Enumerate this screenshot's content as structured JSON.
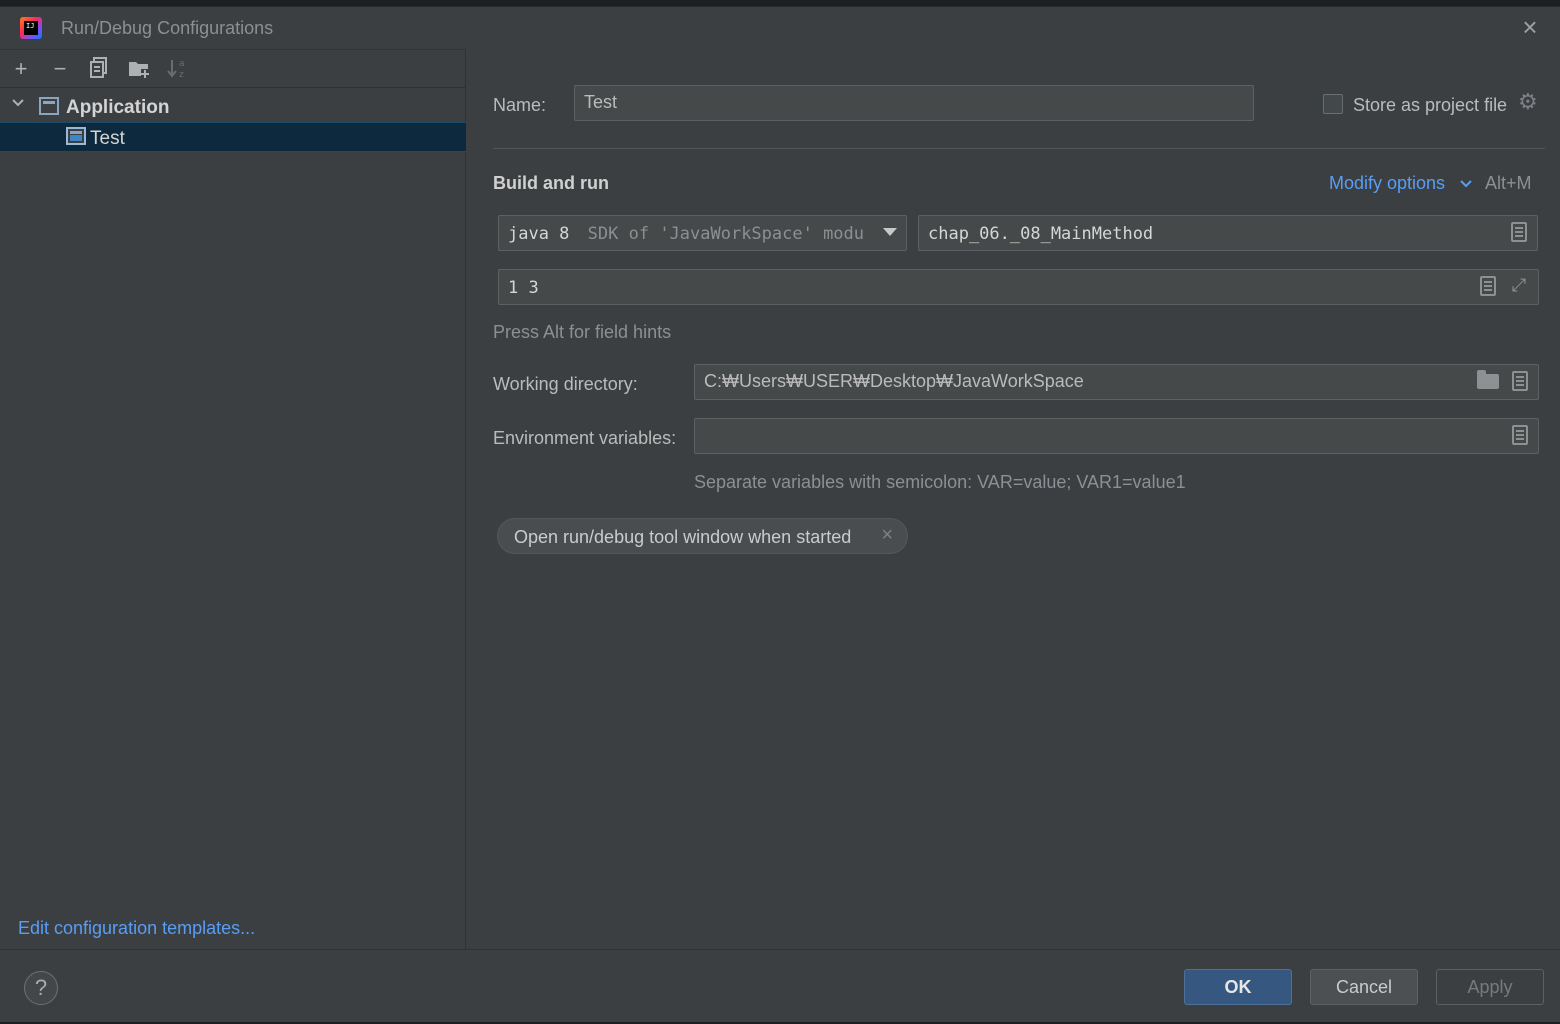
{
  "window": {
    "title": "Run/Debug Configurations",
    "close_icon": "close-icon"
  },
  "toolbar": {
    "add": "+",
    "remove": "−",
    "copy_icon": "copy-icon",
    "folder_icon": "new-folder-icon",
    "sort_icon": "sort-icon"
  },
  "tree": {
    "group_label": "Application",
    "item_label": "Test"
  },
  "left_footer": {
    "edit_templates": "Edit configuration templates..."
  },
  "form": {
    "name_label": "Name:",
    "name_value": "Test",
    "store_label": "Store as project file",
    "section_title": "Build and run",
    "modify_options": "Modify options",
    "modify_shortcut": "Alt+M",
    "sdk_value": "java 8",
    "sdk_detail": "SDK of 'JavaWorkSpace' modu",
    "main_class": "chap_06._08_MainMethod",
    "program_args": "1 3",
    "field_hints": "Press Alt for field hints",
    "working_dir_label": "Working directory:",
    "working_dir_value": "C:₩Users₩USER₩Desktop₩JavaWorkSpace",
    "env_label": "Environment variables:",
    "env_value": "",
    "env_hint": "Separate variables with semicolon: VAR=value; VAR1=value1",
    "chip_label": "Open run/debug tool window when started",
    "chip_close": "×"
  },
  "footer": {
    "help": "?",
    "ok": "OK",
    "cancel": "Cancel",
    "apply": "Apply"
  },
  "colors": {
    "background": "#3c3f41",
    "selection": "#0d293e",
    "link": "#589df6",
    "ok_button": "#365880"
  }
}
